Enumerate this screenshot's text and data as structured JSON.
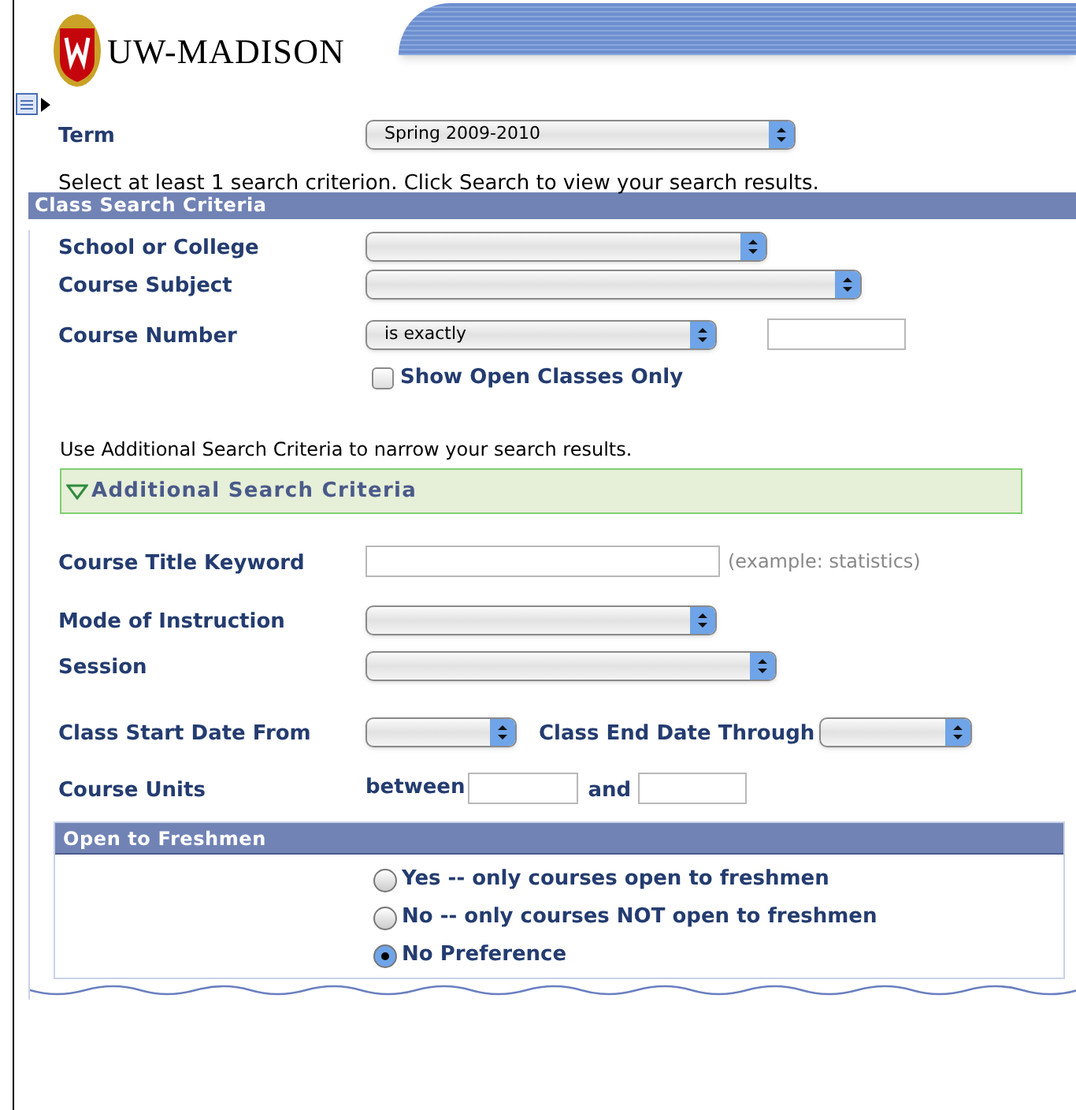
{
  "header": {
    "logo_text": "UW-MADISON"
  },
  "term": {
    "label": "Term",
    "value": "Spring 2009-2010"
  },
  "instruction": "Select at least 1 search criterion. Click Search to view your search results.",
  "criteria": {
    "title": "Class Search Criteria",
    "school": {
      "label": "School or College"
    },
    "subject": {
      "label": "Course Subject"
    },
    "number": {
      "label": "Course Number",
      "operator": "is exactly"
    },
    "open_only": {
      "label": "Show Open Classes Only",
      "checked": false
    }
  },
  "additional_note": "Use Additional Search Criteria to narrow your search results.",
  "additional": {
    "title": "Additional Search Criteria",
    "expanded": true,
    "keyword": {
      "label": "Course Title Keyword",
      "hint": "(example:  statistics)"
    },
    "mode": {
      "label": "Mode of Instruction"
    },
    "session": {
      "label": "Session"
    },
    "start": {
      "label": "Class Start Date From"
    },
    "end": {
      "label": "Class End Date Through"
    },
    "units": {
      "label": "Course Units",
      "between": "between",
      "and": "and"
    }
  },
  "freshmen": {
    "title": "Open to Freshmen",
    "options": [
      {
        "label": "Yes -- only courses open to freshmen",
        "selected": false
      },
      {
        "label": "No -- only courses NOT open to freshmen",
        "selected": false
      },
      {
        "label": "No Preference",
        "selected": true
      }
    ]
  }
}
